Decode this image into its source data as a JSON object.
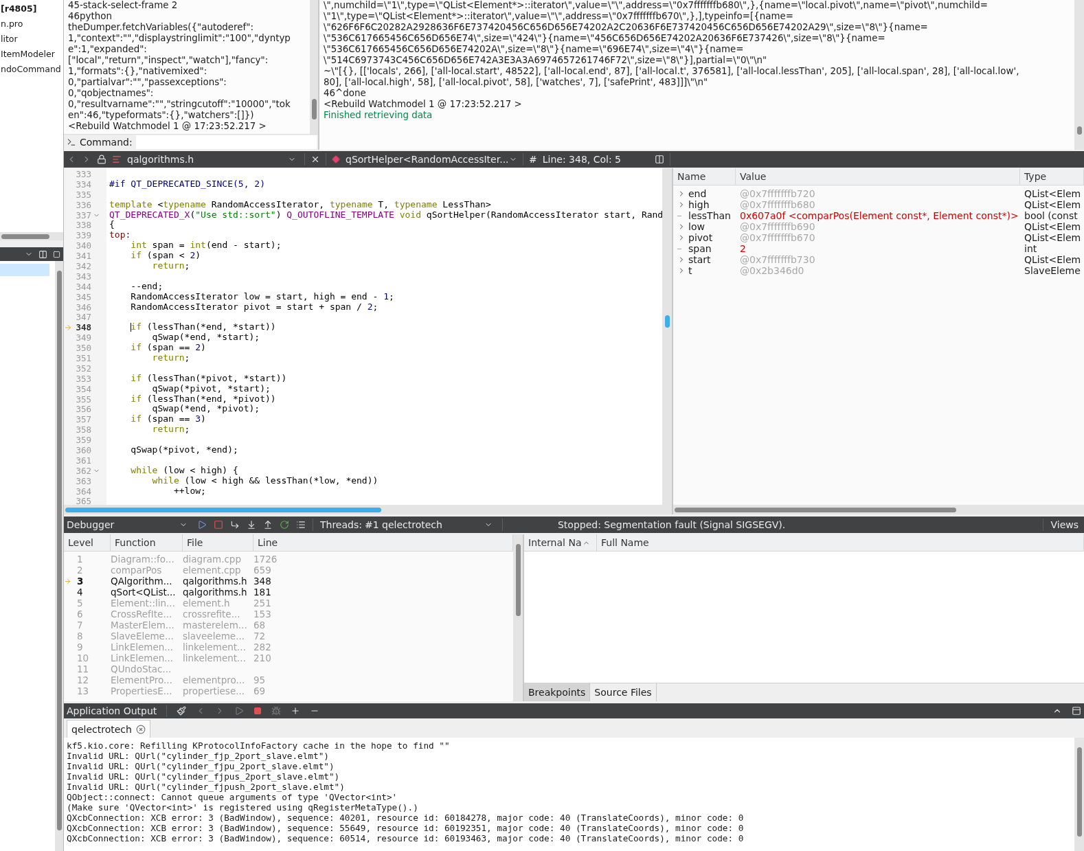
{
  "project_tree": {
    "items": [
      {
        "label": "[r4805]",
        "bold": true
      },
      {
        "label": "n.pro",
        "bold": false
      },
      {
        "label": "litor",
        "bold": false
      },
      {
        "label": "ItemModeler",
        "bold": false
      },
      {
        "label": "ndoCommand",
        "bold": false
      }
    ]
  },
  "outline": {
    "rows": [
      {
        "selected": true
      }
    ]
  },
  "debugger_log": {
    "lines": [
      "45-stack-select-frame 2",
      "46python",
      "theDumper.fetchVariables({\"autoderef\":",
      "1,\"context\":\"\",\"displaystringlimit\":\"100\",\"dyntyp",
      "e\":1,\"expanded\":",
      "[\"local\",\"return\",\"inspect\",\"watch\"],\"fancy\":",
      "1,\"formats\":{},\"nativemixed\":",
      "0,\"partialvar\":\"\",\"passexceptions\":",
      "0,\"qobjectnames\":",
      "0,\"resultvarname\":\"\",\"stringcutoff\":\"10000\",\"tok",
      "en\":46,\"typeformats\":{},\"watchers\":[]})",
      "<Rebuild Watchmodel 1 @ 17:23:52.217 >"
    ],
    "command_label": "Command:"
  },
  "gdb_log": {
    "lines": [
      {
        "kind": "plain",
        "text": "\\\",numchild=\\\"1\\\",type=\\\"QList<Element*>::iterator\\\",value=\\\"\\\",address=\\\"0x7fffffffb680\\\",},{name=\\\"local.pivot\\\",name=\\\"pivot\\\",numchild="
      },
      {
        "kind": "plain",
        "text": "\\\"1\\\",type=\\\"QList<Element*>::iterator\\\",value=\\\"\\\",address=\\\"0x7fffffffb670\\\",},],typeinfo=[{name="
      },
      {
        "kind": "plain",
        "text": "\\\"626F6F6C20282A2928636F6E737420456C656D656E74202A2C20636F6E737420456C656D656E74202A29\\\",size=\\\"8\\\"}{name="
      },
      {
        "kind": "plain",
        "text": "\\\"536C617665456C656D656E74\\\",size=\\\"424\\\"}{name=\\\"456C656D656E74202A20636F6E737426\\\",size=\\\"8\\\"}{name="
      },
      {
        "kind": "plain",
        "text": "\\\"536C617665456C656D656E74202A\\\",size=\\\"8\\\"}{name=\\\"696E74\\\",size=\\\"4\\\"}{name="
      },
      {
        "kind": "plain",
        "text": "\\\"514C6973743C456C656D656E742A3E3A3A6974657261746F72\\\",size=\\\"8\\\"}],partial=\\\"0\\\"\\n\""
      },
      {
        "kind": "plain",
        "text": "~\\\"[{}, [['locals', 266], ['all-local.start', 48522], ['all-local.end', 87], ['all-local.t', 376581], ['all-local.lessThan', 205], ['all-local.span', 28], ['all-local.low',"
      },
      {
        "kind": "plain",
        "text": "80], ['all-local.high', 58], ['all-local.pivot', 58], ['watches', 7], ['safePrint', 483]]]\\\"\\n\""
      },
      {
        "kind": "plain",
        "text": "46^done"
      },
      {
        "kind": "plain",
        "text": "<Rebuild Watchmodel 1 @ 17:23:52.217 >"
      },
      {
        "kind": "status",
        "text": "Finished retrieving data"
      }
    ]
  },
  "editor": {
    "file": "qalgorithms.h",
    "symbol": "qSortHelper<RandomAccessIter...",
    "hash_label": "#",
    "position": "Line: 348, Col: 5",
    "lines": [
      {
        "number": "333",
        "current": false,
        "foldable": false
      },
      {
        "number": "334",
        "current": false,
        "foldable": false,
        "tokens": [
          {
            "kind": "pp",
            "text": "#if QT_DEPRECATED_SINCE(5, 2)"
          }
        ]
      },
      {
        "number": "335",
        "current": false,
        "foldable": false
      },
      {
        "number": "336",
        "current": false,
        "foldable": false,
        "tokens": [
          {
            "kind": "kw",
            "text": "template"
          },
          {
            "kind": "plain",
            "text": " <"
          },
          {
            "kind": "kw",
            "text": "typename"
          },
          {
            "kind": "plain",
            "text": " RandomAccessIterator, "
          },
          {
            "kind": "kw",
            "text": "typename"
          },
          {
            "kind": "plain",
            "text": " T, "
          },
          {
            "kind": "kw",
            "text": "typename"
          },
          {
            "kind": "plain",
            "text": " LessThan>"
          }
        ]
      },
      {
        "number": "337",
        "current": false,
        "foldable": true,
        "tokens": [
          {
            "kind": "macro",
            "text": "QT_DEPRECATED_X"
          },
          {
            "kind": "plain",
            "text": "("
          },
          {
            "kind": "str",
            "text": "\"Use std::sort\""
          },
          {
            "kind": "plain",
            "text": ") "
          },
          {
            "kind": "macro",
            "text": "Q_OUTOFLINE_TEMPLATE"
          },
          {
            "kind": "kw",
            "text": " void"
          },
          {
            "kind": "plain",
            "text": " qSortHelper(RandomAccessIterator start, Rand"
          }
        ]
      },
      {
        "number": "338",
        "current": false,
        "foldable": false,
        "tokens": [
          {
            "kind": "plain",
            "text": "{"
          }
        ]
      },
      {
        "number": "339",
        "current": false,
        "foldable": false,
        "tokens": [
          {
            "kind": "label",
            "text": "top"
          },
          {
            "kind": "plain",
            "text": ":"
          }
        ]
      },
      {
        "number": "340",
        "current": false,
        "foldable": false,
        "tokens": [
          {
            "kind": "kw",
            "text": "    int"
          },
          {
            "kind": "plain",
            "text": " span = "
          },
          {
            "kind": "kw",
            "text": "int"
          },
          {
            "kind": "plain",
            "text": "(end - start);"
          }
        ]
      },
      {
        "number": "341",
        "current": false,
        "foldable": false,
        "tokens": [
          {
            "kind": "kw",
            "text": "    if"
          },
          {
            "kind": "plain",
            "text": " (span < "
          },
          {
            "kind": "num",
            "text": "2"
          },
          {
            "kind": "plain",
            "text": ")"
          }
        ]
      },
      {
        "number": "342",
        "current": false,
        "foldable": false,
        "tokens": [
          {
            "kind": "kw",
            "text": "        return"
          },
          {
            "kind": "plain",
            "text": ";"
          }
        ]
      },
      {
        "number": "343",
        "current": false,
        "foldable": false
      },
      {
        "number": "344",
        "current": false,
        "foldable": false,
        "tokens": [
          {
            "kind": "plain",
            "text": "    --end;"
          }
        ]
      },
      {
        "number": "345",
        "current": false,
        "foldable": false,
        "tokens": [
          {
            "kind": "plain",
            "text": "    RandomAccessIterator low = start, high = end - "
          },
          {
            "kind": "num",
            "text": "1"
          },
          {
            "kind": "plain",
            "text": ";"
          }
        ]
      },
      {
        "number": "346",
        "current": false,
        "foldable": false,
        "tokens": [
          {
            "kind": "plain",
            "text": "    RandomAccessIterator pivot = start + span / "
          },
          {
            "kind": "num",
            "text": "2"
          },
          {
            "kind": "plain",
            "text": ";"
          }
        ]
      },
      {
        "number": "347",
        "current": false,
        "foldable": false
      },
      {
        "number": "348",
        "current": true,
        "foldable": false,
        "tokens": [
          {
            "kind": "kw",
            "text": "    if"
          },
          {
            "kind": "plain",
            "text": " (lessThan(*end, *start))"
          }
        ]
      },
      {
        "number": "349",
        "current": false,
        "foldable": false,
        "tokens": [
          {
            "kind": "plain",
            "text": "        qSwap(*end, *start);"
          }
        ]
      },
      {
        "number": "350",
        "current": false,
        "foldable": false,
        "tokens": [
          {
            "kind": "kw",
            "text": "    if"
          },
          {
            "kind": "plain",
            "text": " (span == "
          },
          {
            "kind": "num",
            "text": "2"
          },
          {
            "kind": "plain",
            "text": ")"
          }
        ]
      },
      {
        "number": "351",
        "current": false,
        "foldable": false,
        "tokens": [
          {
            "kind": "kw",
            "text": "        return"
          },
          {
            "kind": "plain",
            "text": ";"
          }
        ]
      },
      {
        "number": "352",
        "current": false,
        "foldable": false
      },
      {
        "number": "353",
        "current": false,
        "foldable": false,
        "tokens": [
          {
            "kind": "kw",
            "text": "    if"
          },
          {
            "kind": "plain",
            "text": " (lessThan(*pivot, *start))"
          }
        ]
      },
      {
        "number": "354",
        "current": false,
        "foldable": false,
        "tokens": [
          {
            "kind": "plain",
            "text": "        qSwap(*pivot, *start);"
          }
        ]
      },
      {
        "number": "355",
        "current": false,
        "foldable": false,
        "tokens": [
          {
            "kind": "kw",
            "text": "    if"
          },
          {
            "kind": "plain",
            "text": " (lessThan(*end, *pivot))"
          }
        ]
      },
      {
        "number": "356",
        "current": false,
        "foldable": false,
        "tokens": [
          {
            "kind": "plain",
            "text": "        qSwap(*end, *pivot);"
          }
        ]
      },
      {
        "number": "357",
        "current": false,
        "foldable": false,
        "tokens": [
          {
            "kind": "kw",
            "text": "    if"
          },
          {
            "kind": "plain",
            "text": " (span == "
          },
          {
            "kind": "num",
            "text": "3"
          },
          {
            "kind": "plain",
            "text": ")"
          }
        ]
      },
      {
        "number": "358",
        "current": false,
        "foldable": false,
        "tokens": [
          {
            "kind": "kw",
            "text": "        return"
          },
          {
            "kind": "plain",
            "text": ";"
          }
        ]
      },
      {
        "number": "359",
        "current": false,
        "foldable": false
      },
      {
        "number": "360",
        "current": false,
        "foldable": false,
        "tokens": [
          {
            "kind": "plain",
            "text": "    qSwap(*pivot, *end);"
          }
        ]
      },
      {
        "number": "361",
        "current": false,
        "foldable": false
      },
      {
        "number": "362",
        "current": false,
        "foldable": true,
        "tokens": [
          {
            "kind": "kw",
            "text": "    while"
          },
          {
            "kind": "plain",
            "text": " (low < high) {"
          }
        ]
      },
      {
        "number": "363",
        "current": false,
        "foldable": false,
        "tokens": [
          {
            "kind": "kw",
            "text": "        while"
          },
          {
            "kind": "plain",
            "text": " (low < high && lessThan(*low, *end))"
          }
        ]
      },
      {
        "number": "364",
        "current": false,
        "foldable": false,
        "tokens": [
          {
            "kind": "plain",
            "text": "            ++low;"
          }
        ]
      },
      {
        "number": "365",
        "current": false,
        "foldable": false
      }
    ]
  },
  "locals": {
    "columns": [
      "Name",
      "Value",
      "Type"
    ],
    "rows": [
      {
        "name": "end",
        "value": "@0x7fffffffb720",
        "type": "QList<Elem",
        "expandable": true,
        "changed": false
      },
      {
        "name": "high",
        "value": "@0x7fffffffb680",
        "type": "QList<Elem",
        "expandable": true,
        "changed": false
      },
      {
        "name": "lessThan",
        "value": "0x607a0f <comparPos(Element const*, Element const*)>",
        "type": "bool (const",
        "expandable": false,
        "changed": true
      },
      {
        "name": "low",
        "value": "@0x7fffffffb690",
        "type": "QList<Elem",
        "expandable": true,
        "changed": false
      },
      {
        "name": "pivot",
        "value": "@0x7fffffffb670",
        "type": "QList<Elem",
        "expandable": true,
        "changed": false
      },
      {
        "name": "span",
        "value": "2",
        "type": "int",
        "expandable": false,
        "changed": true
      },
      {
        "name": "start",
        "value": "@0x7fffffffb730",
        "type": "QList<Elem",
        "expandable": true,
        "changed": false
      },
      {
        "name": "t",
        "value": "@0x2b346d0",
        "type": "SlaveEleme",
        "expandable": true,
        "changed": false
      }
    ]
  },
  "debugger_toolbar": {
    "mode": "Debugger",
    "threads_label": "Threads:",
    "thread": "#1 qelectrotech",
    "status": "Stopped: Segmentation fault (Signal SIGSEGV).",
    "views": "Views"
  },
  "stack": {
    "columns": [
      "Level",
      "Function",
      "File",
      "Line"
    ],
    "frames": [
      {
        "level": "1",
        "function": "Diagram::fo...",
        "file": "diagram.cpp",
        "line": "1726",
        "current": false,
        "has_source": false
      },
      {
        "level": "2",
        "function": "comparPos",
        "file": "element.cpp",
        "line": "659",
        "current": false,
        "has_source": false
      },
      {
        "level": "3",
        "function": "QAlgorithm...",
        "file": "qalgorithms.h",
        "line": "348",
        "current": true,
        "has_source": true
      },
      {
        "level": "4",
        "function": "qSort<QList...",
        "file": "qalgorithms.h",
        "line": "181",
        "current": false,
        "has_source": true
      },
      {
        "level": "5",
        "function": "Element::lin...",
        "file": "element.h",
        "line": "251",
        "current": false,
        "has_source": false
      },
      {
        "level": "6",
        "function": "CrossRefIte...",
        "file": "crossrefite...",
        "line": "153",
        "current": false,
        "has_source": false
      },
      {
        "level": "7",
        "function": "MasterElem...",
        "file": "masterelem...",
        "line": "68",
        "current": false,
        "has_source": false
      },
      {
        "level": "8",
        "function": "SlaveEleme...",
        "file": "slaveeleme...",
        "line": "72",
        "current": false,
        "has_source": false
      },
      {
        "level": "9",
        "function": "LinkElemen...",
        "file": "linkelement...",
        "line": "282",
        "current": false,
        "has_source": false
      },
      {
        "level": "10",
        "function": "LinkElemen...",
        "file": "linkelement...",
        "line": "210",
        "current": false,
        "has_source": false
      },
      {
        "level": "11",
        "function": "QUndoStac...",
        "current": false,
        "has_source": false
      },
      {
        "level": "12",
        "function": "ElementPro...",
        "file": "elementpro...",
        "line": "95",
        "current": false,
        "has_source": false
      },
      {
        "level": "13",
        "function": "PropertiesE...",
        "file": "propertiese...",
        "line": "69",
        "current": false,
        "has_source": false
      }
    ]
  },
  "modules": {
    "columns": [
      "Internal Na",
      "Full Name"
    ],
    "tabs": [
      {
        "label": "Breakpoints",
        "selected": true
      },
      {
        "label": "Source Files",
        "selected": false
      }
    ]
  },
  "output": {
    "title": "Application Output",
    "tabs": [
      {
        "label": "qelectrotech",
        "selected": true
      }
    ],
    "lines": [
      "kf5.kio.core: Refilling KProtocolInfoFactory cache in the hope to find \"\"",
      "Invalid URL: QUrl(\"cylinder_fjp_2port_slave.elmt\")",
      "Invalid URL: QUrl(\"cylinder_fjpu_2port_slave.elmt\")",
      "Invalid URL: QUrl(\"cylinder_fjpus_2port_slave.elmt\")",
      "Invalid URL: QUrl(\"cylinder_fjpush_2port_slave.elmt\")",
      "QObject::connect: Cannot queue arguments of type 'QVector<int>'",
      "(Make sure 'QVector<int>' is registered using qRegisterMetaType().)",
      "QXcbConnection: XCB error: 3 (BadWindow), sequence: 40201, resource id: 60184278, major code: 40 (TranslateCoords), minor code: 0",
      "QXcbConnection: XCB error: 3 (BadWindow), sequence: 55649, resource id: 60192351, major code: 40 (TranslateCoords), minor code: 0",
      "QXcbConnection: XCB error: 3 (BadWindow), sequence: 60514, resource id: 60193463, major code: 40 (TranslateCoords), minor code: 0"
    ]
  }
}
